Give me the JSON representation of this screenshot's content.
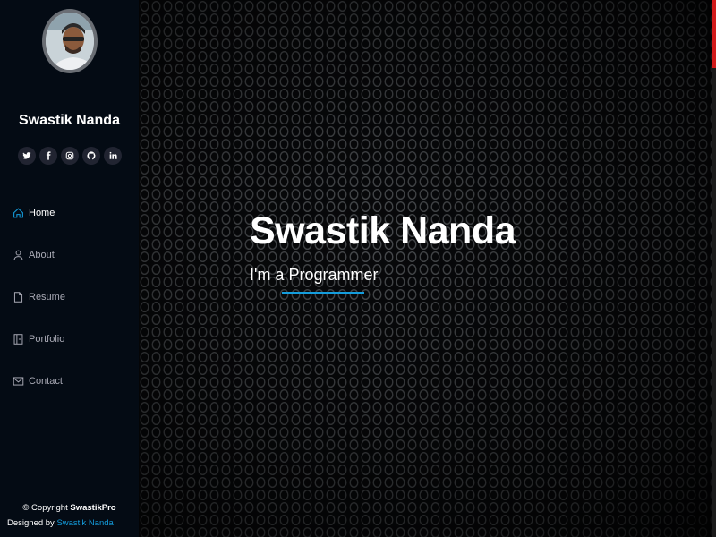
{
  "sidebar": {
    "name": "Swastik Nanda",
    "social": [
      {
        "icon": "twitter-icon",
        "glyph": "🐦"
      },
      {
        "icon": "facebook-icon",
        "glyph": "f"
      },
      {
        "icon": "instagram-icon",
        "glyph": "◘"
      },
      {
        "icon": "github-icon",
        "glyph": "⌂"
      },
      {
        "icon": "linkedin-icon",
        "glyph": "in"
      }
    ],
    "nav": [
      {
        "label": "Home",
        "icon": "home-icon",
        "active": true
      },
      {
        "label": "About",
        "icon": "user-icon",
        "active": false
      },
      {
        "label": "Resume",
        "icon": "file-icon",
        "active": false
      },
      {
        "label": "Portfolio",
        "icon": "book-icon",
        "active": false
      },
      {
        "label": "Contact",
        "icon": "envelope-icon",
        "active": false
      }
    ],
    "footer": {
      "copyright_prefix": "© Copyright",
      "copyright_brand": "SwastikPro",
      "designed_prefix": "Designed by",
      "designer": "Swastik Nanda"
    }
  },
  "hero": {
    "title": "Swastik Nanda",
    "subtitle": "I'm a Programmer"
  },
  "colors": {
    "accent": "#149ddd",
    "sidebar_bg": "#040b14",
    "scroll_thumb": "#d11a1a"
  }
}
